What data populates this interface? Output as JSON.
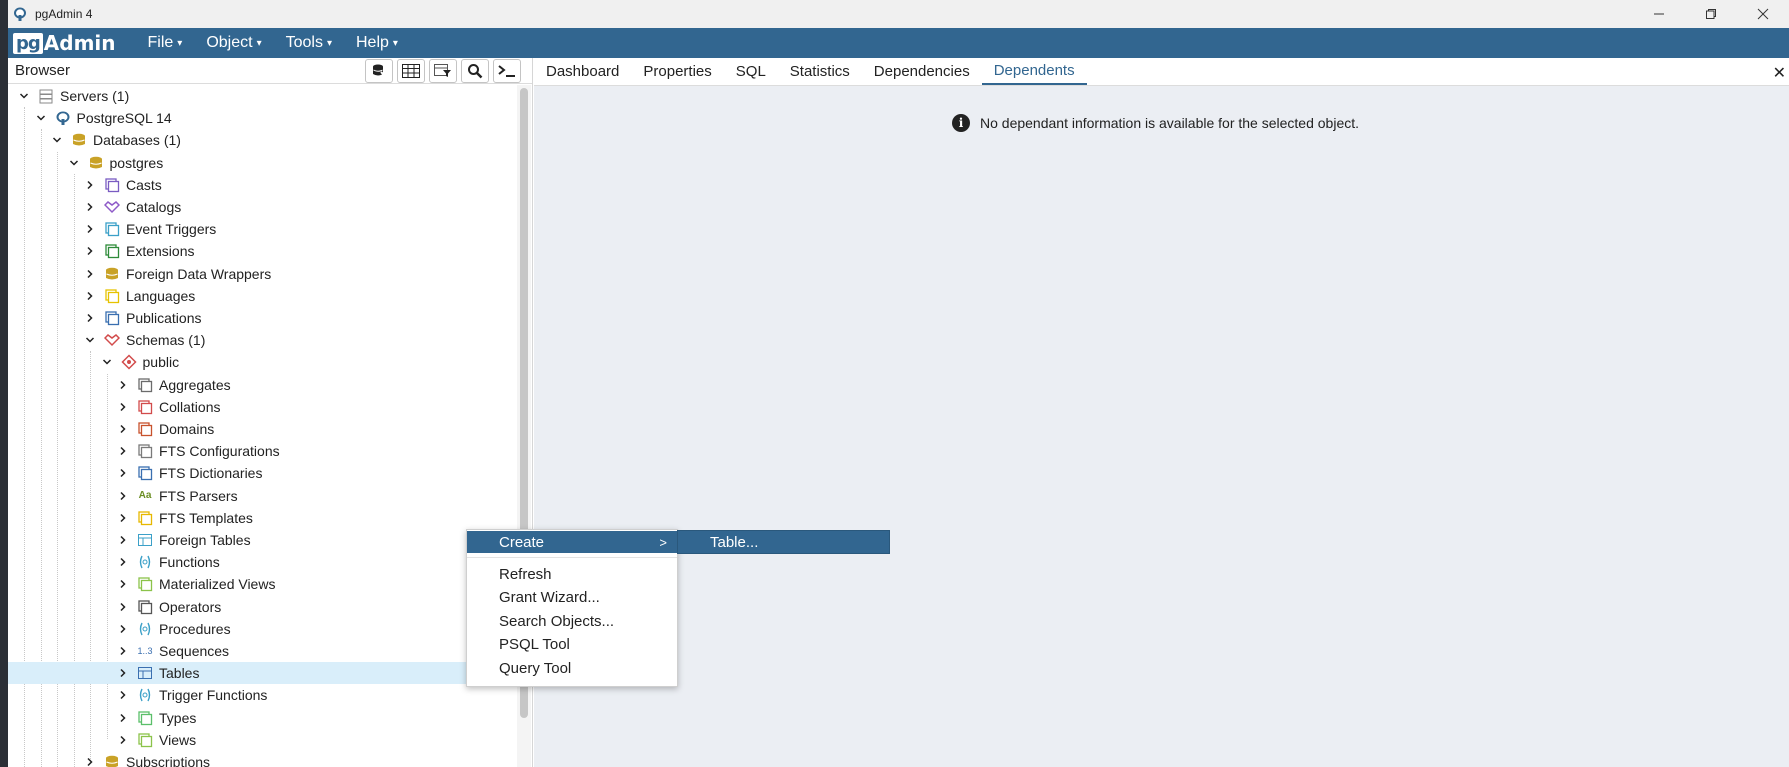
{
  "window": {
    "title": "pgAdmin 4"
  },
  "app": {
    "logo_pg": "pg",
    "logo_admin": "Admin"
  },
  "menubar": [
    "File",
    "Object",
    "Tools",
    "Help"
  ],
  "browser": {
    "title": "Browser",
    "tree": [
      {
        "label": "Servers (1)",
        "level": 0,
        "expanded": true,
        "icon": "servers-icon",
        "color": "#8a8a8a"
      },
      {
        "label": "PostgreSQL 14",
        "level": 1,
        "expanded": true,
        "icon": "postgres-elephant-icon",
        "color": "#336791"
      },
      {
        "label": "Databases (1)",
        "level": 2,
        "expanded": true,
        "icon": "databases-icon",
        "color": "#c9a227"
      },
      {
        "label": "postgres",
        "level": 3,
        "expanded": true,
        "icon": "database-icon",
        "color": "#c9a227"
      },
      {
        "label": "Casts",
        "level": 4,
        "expanded": false,
        "icon": "casts-icon",
        "color": "#7a5cc2"
      },
      {
        "label": "Catalogs",
        "level": 4,
        "expanded": false,
        "icon": "catalogs-icon",
        "color": "#8e5ac8"
      },
      {
        "label": "Event Triggers",
        "level": 4,
        "expanded": false,
        "icon": "event-triggers-icon",
        "color": "#3ba0c8"
      },
      {
        "label": "Extensions",
        "level": 4,
        "expanded": false,
        "icon": "extensions-icon",
        "color": "#2e8b3a"
      },
      {
        "label": "Foreign Data Wrappers",
        "level": 4,
        "expanded": false,
        "icon": "foreign-data-wrappers-icon",
        "color": "#c9a227"
      },
      {
        "label": "Languages",
        "level": 4,
        "expanded": false,
        "icon": "languages-icon",
        "color": "#e6c300"
      },
      {
        "label": "Publications",
        "level": 4,
        "expanded": false,
        "icon": "publications-icon",
        "color": "#3a6fb0"
      },
      {
        "label": "Schemas (1)",
        "level": 4,
        "expanded": true,
        "icon": "schemas-icon",
        "color": "#d24b4b"
      },
      {
        "label": "public",
        "level": 5,
        "expanded": true,
        "icon": "schema-icon",
        "color": "#d24b4b"
      },
      {
        "label": "Aggregates",
        "level": 6,
        "expanded": false,
        "icon": "aggregates-icon",
        "color": "#6b6b6b"
      },
      {
        "label": "Collations",
        "level": 6,
        "expanded": false,
        "icon": "collations-icon",
        "color": "#d24b4b"
      },
      {
        "label": "Domains",
        "level": 6,
        "expanded": false,
        "icon": "domains-icon",
        "color": "#c8522c"
      },
      {
        "label": "FTS Configurations",
        "level": 6,
        "expanded": false,
        "icon": "fts-configurations-icon",
        "color": "#7a7a7a"
      },
      {
        "label": "FTS Dictionaries",
        "level": 6,
        "expanded": false,
        "icon": "fts-dictionaries-icon",
        "color": "#3a6fb0"
      },
      {
        "label": "FTS Parsers",
        "level": 6,
        "expanded": false,
        "icon": "fts-parsers-icon",
        "color": "#6b8e23"
      },
      {
        "label": "FTS Templates",
        "level": 6,
        "expanded": false,
        "icon": "fts-templates-icon",
        "color": "#e6b800"
      },
      {
        "label": "Foreign Tables",
        "level": 6,
        "expanded": false,
        "icon": "foreign-tables-icon",
        "color": "#3ba0c8"
      },
      {
        "label": "Functions",
        "level": 6,
        "expanded": false,
        "icon": "functions-icon",
        "color": "#3ba0c8"
      },
      {
        "label": "Materialized Views",
        "level": 6,
        "expanded": false,
        "icon": "materialized-views-icon",
        "color": "#8bc34a"
      },
      {
        "label": "Operators",
        "level": 6,
        "expanded": false,
        "icon": "operators-icon",
        "color": "#555555"
      },
      {
        "label": "Procedures",
        "level": 6,
        "expanded": false,
        "icon": "procedures-icon",
        "color": "#3ba0c8"
      },
      {
        "label": "Sequences",
        "level": 6,
        "expanded": false,
        "icon": "sequences-icon",
        "color": "#3a6fb0"
      },
      {
        "label": "Tables",
        "level": 6,
        "expanded": false,
        "icon": "tables-icon",
        "color": "#3a6fb0",
        "selected": true
      },
      {
        "label": "Trigger Functions",
        "level": 6,
        "expanded": false,
        "icon": "trigger-functions-icon",
        "color": "#3ba0c8"
      },
      {
        "label": "Types",
        "level": 6,
        "expanded": false,
        "icon": "types-icon",
        "color": "#5bbf6a"
      },
      {
        "label": "Views",
        "level": 6,
        "expanded": false,
        "icon": "views-icon",
        "color": "#8bc34a"
      },
      {
        "label": "Subscriptions",
        "level": 4,
        "expanded": false,
        "icon": "subscriptions-icon",
        "color": "#c9a227"
      }
    ]
  },
  "tabs": [
    {
      "label": "Dashboard",
      "active": false
    },
    {
      "label": "Properties",
      "active": false
    },
    {
      "label": "SQL",
      "active": false
    },
    {
      "label": "Statistics",
      "active": false
    },
    {
      "label": "Dependencies",
      "active": false
    },
    {
      "label": "Dependents",
      "active": true
    }
  ],
  "main": {
    "message": "No dependant information is available for the selected object."
  },
  "context_menu": {
    "items": [
      "Create",
      "Refresh",
      "Grant Wizard...",
      "Search Objects...",
      "PSQL Tool",
      "Query Tool"
    ],
    "submenu": [
      "Table..."
    ]
  },
  "colors": {
    "accent": "#326690",
    "selected_row": "#d9eefa",
    "main_bg": "#ebeef3"
  }
}
